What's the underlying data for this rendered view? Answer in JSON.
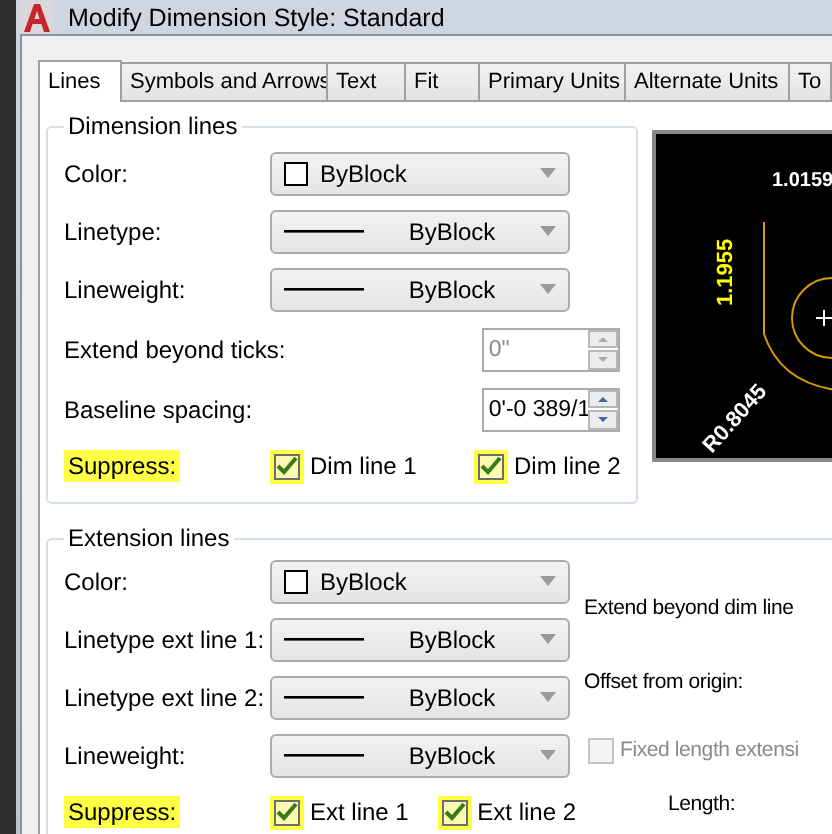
{
  "window": {
    "title": "Modify Dimension Style: Standard"
  },
  "tabs": [
    {
      "label": "Lines",
      "selected": true
    },
    {
      "label": "Symbols and Arrows",
      "selected": false
    },
    {
      "label": "Text",
      "selected": false
    },
    {
      "label": "Fit",
      "selected": false
    },
    {
      "label": "Primary Units",
      "selected": false
    },
    {
      "label": "Alternate Units",
      "selected": false
    },
    {
      "label": "To",
      "selected": false
    }
  ],
  "dimension_lines": {
    "title": "Dimension lines",
    "rows": [
      {
        "kind": "color",
        "label": "Color:",
        "value": "ByBlock"
      },
      {
        "kind": "line",
        "label": "Linetype:",
        "value": "ByBlock"
      },
      {
        "kind": "line",
        "label": "Lineweight:",
        "value": "ByBlock"
      },
      {
        "kind": "spin",
        "label": "Extend beyond ticks:",
        "value": "0\"",
        "disabled": true
      },
      {
        "kind": "spin",
        "label": "Baseline spacing:",
        "value": "0'-0 389/1",
        "disabled": false
      }
    ],
    "suppress": {
      "label": "Suppress:",
      "options": [
        {
          "label": "Dim line 1",
          "checked": true
        },
        {
          "label": "Dim line 2",
          "checked": true
        }
      ]
    }
  },
  "preview": {
    "labels": [
      "1.0159",
      "1.1955",
      "R0.8045"
    ]
  },
  "extension_lines": {
    "title": "Extension lines",
    "rows": [
      {
        "kind": "color",
        "label": "Color:",
        "value": "ByBlock"
      },
      {
        "kind": "line",
        "label": "Linetype ext line 1:",
        "value": "ByBlock"
      },
      {
        "kind": "line",
        "label": "Linetype ext line 2:",
        "value": "ByBlock"
      },
      {
        "kind": "line",
        "label": "Lineweight:",
        "value": "ByBlock"
      }
    ],
    "suppress": {
      "label": "Suppress:",
      "options": [
        {
          "label": "Ext line 1",
          "checked": true
        },
        {
          "label": "Ext line 2",
          "checked": true
        }
      ]
    },
    "extend_beyond_dim_lines": {
      "label": "Extend beyond dim line"
    },
    "offset_from_origin": {
      "label": "Offset from origin:"
    },
    "fixed_length": {
      "label": "Fixed length extensi",
      "checked": false,
      "disabled": true
    },
    "length": {
      "label": "Length:"
    }
  }
}
